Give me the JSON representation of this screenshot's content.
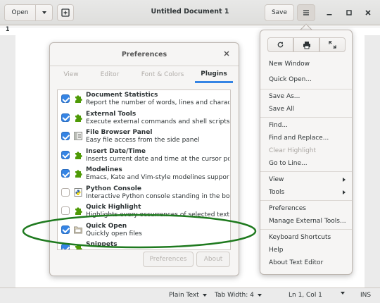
{
  "header": {
    "open_label": "Open",
    "title": "Untitled Document 1",
    "save_label": "Save"
  },
  "editor": {
    "line_number": "1"
  },
  "statusbar": {
    "language": "Plain Text",
    "tab_width": "Tab Width: 4",
    "position": "Ln 1, Col 1",
    "mode": "INS"
  },
  "dialog": {
    "title": "Preferences",
    "tabs": [
      "View",
      "Editor",
      "Font & Colors",
      "Plugins"
    ],
    "active_tab": "Plugins",
    "plugins": [
      {
        "name": "Document Statistics",
        "desc": "Report the number of words, lines and charact...",
        "checked": true,
        "icon": "puzzle-icon"
      },
      {
        "name": "External Tools",
        "desc": "Execute external commands and shell scripts.",
        "checked": true,
        "icon": "puzzle-icon"
      },
      {
        "name": "File Browser Panel",
        "desc": "Easy file access from the side panel",
        "checked": true,
        "icon": "file-browser-icon"
      },
      {
        "name": "Insert Date/Time",
        "desc": "Inserts current date and time at the cursor posi...",
        "checked": true,
        "icon": "puzzle-icon"
      },
      {
        "name": "Modelines",
        "desc": "Emacs, Kate and Vim-style modelines support f...",
        "checked": true,
        "icon": "puzzle-icon"
      },
      {
        "name": "Python Console",
        "desc": "Interactive Python console standing in the bot...",
        "checked": false,
        "icon": "python-console-icon"
      },
      {
        "name": "Quick Highlight",
        "desc": "Highlights every occurrences of selected text",
        "checked": false,
        "icon": "puzzle-icon"
      },
      {
        "name": "Quick Open",
        "desc": "Quickly open files",
        "checked": true,
        "icon": "folder-icon"
      },
      {
        "name": "Snippets",
        "desc": "",
        "checked": true,
        "icon": "puzzle-icon"
      }
    ],
    "preferences_button": "Preferences",
    "about_button": "About"
  },
  "menu": {
    "icons": [
      "reload-icon",
      "print-icon",
      "fullscreen-icon"
    ],
    "items": [
      {
        "label": "New Window",
        "disabled": false,
        "submenu": false
      },
      {
        "label": "Quick Open...",
        "disabled": false,
        "submenu": false
      },
      {
        "label": "Save As...",
        "disabled": false,
        "submenu": false
      },
      {
        "label": "Save All",
        "disabled": false,
        "submenu": false
      },
      {
        "label": "Find...",
        "disabled": false,
        "submenu": false
      },
      {
        "label": "Find and Replace...",
        "disabled": false,
        "submenu": false
      },
      {
        "label": "Clear Highlight",
        "disabled": true,
        "submenu": false
      },
      {
        "label": "Go to Line...",
        "disabled": false,
        "submenu": false
      },
      {
        "label": "View",
        "disabled": false,
        "submenu": true
      },
      {
        "label": "Tools",
        "disabled": false,
        "submenu": true
      },
      {
        "label": "Preferences",
        "disabled": false,
        "submenu": false
      },
      {
        "label": "Manage External Tools...",
        "disabled": false,
        "submenu": false
      },
      {
        "label": "Keyboard Shortcuts",
        "disabled": false,
        "submenu": false
      },
      {
        "label": "Help",
        "disabled": false,
        "submenu": false
      },
      {
        "label": "About Text Editor",
        "disabled": false,
        "submenu": false
      }
    ]
  },
  "colors": {
    "accent": "#3584e4",
    "annotation": "#1f7a1f",
    "puzzle": "#4e9a06"
  }
}
